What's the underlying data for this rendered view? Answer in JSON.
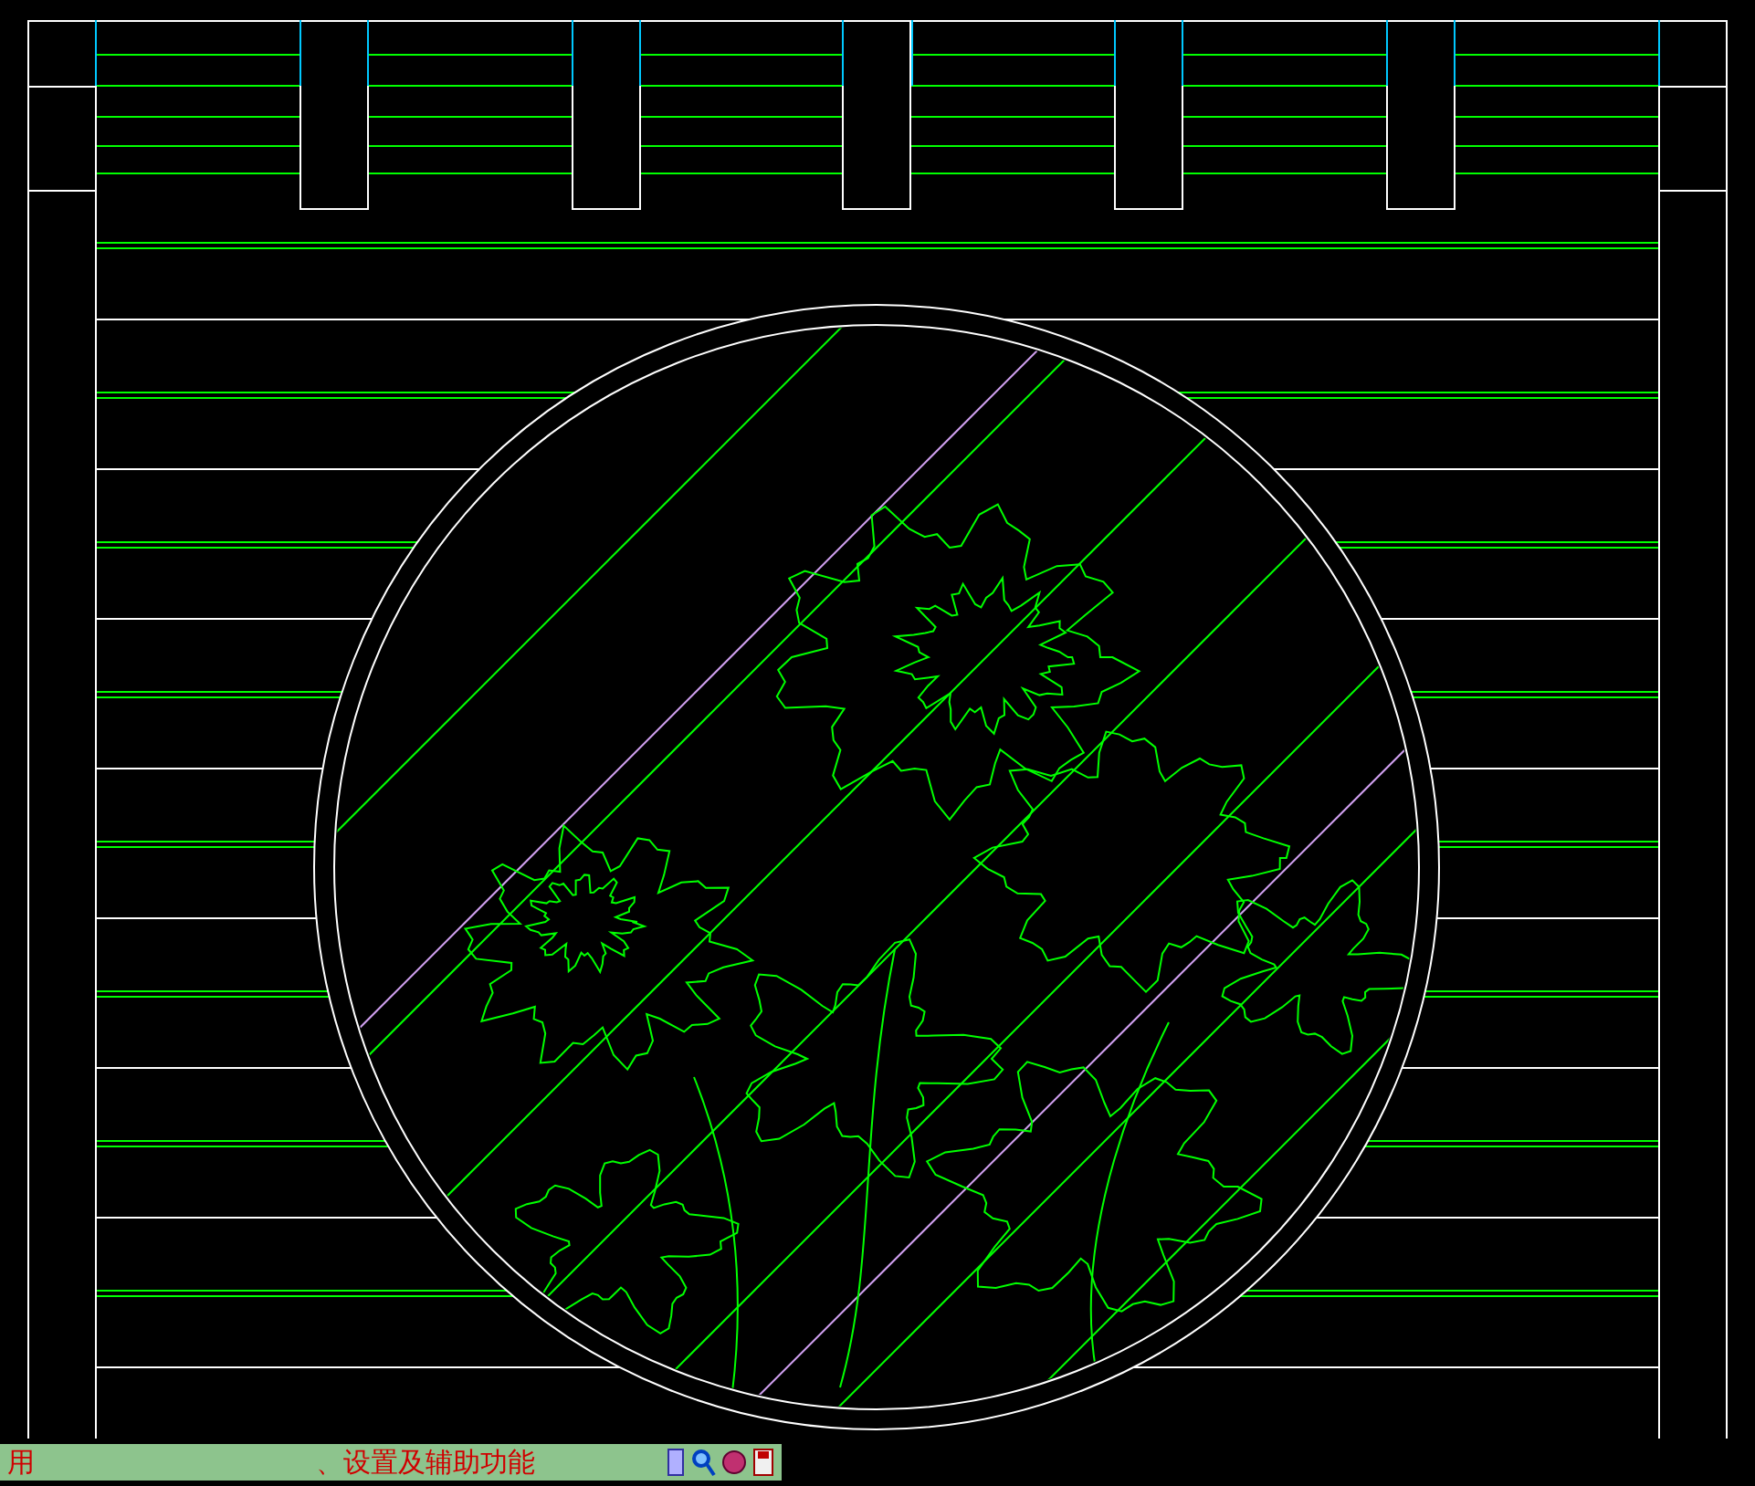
{
  "status_bar": {
    "texts": [
      "用",
      "、设置及辅助功能"
    ]
  }
}
